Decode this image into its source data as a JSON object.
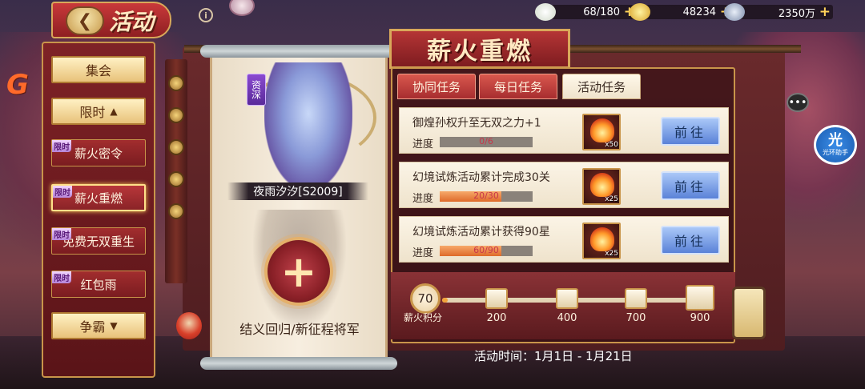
{
  "header": {
    "back_icon": "arrow-left-icon",
    "title": "活动",
    "info_icon": "info-icon"
  },
  "resources": [
    {
      "icon": "steamed-bun-icon",
      "value": "68/180"
    },
    {
      "icon": "gold-ingot-icon",
      "value": "48234"
    },
    {
      "icon": "coin-icon",
      "value": "2350万"
    }
  ],
  "menu": {
    "items": [
      {
        "label": "集会",
        "style": "gold"
      },
      {
        "label": "限时",
        "style": "gold",
        "arrow": "▲"
      },
      {
        "label": "薪火密令",
        "tag": "限时"
      },
      {
        "label": "薪火重燃",
        "tag": "限时",
        "active": true
      },
      {
        "label": "免费无双重生",
        "tag": "限时"
      },
      {
        "label": "红包雨",
        "tag": "限时"
      },
      {
        "label": "争霸",
        "style": "gold",
        "arrow": "▼"
      }
    ]
  },
  "event": {
    "title": "薪火重燃",
    "hero_tag": "资深",
    "hero_name": "夜雨汐汐[S2009]",
    "add_symbol": "+",
    "caption": "结义回归/新征程将军",
    "time_label": "活动时间：1月1日 - 1月21日"
  },
  "tabs": [
    {
      "label": "协同任务",
      "active": false
    },
    {
      "label": "每日任务",
      "active": false
    },
    {
      "label": "活动任务",
      "active": true
    }
  ],
  "tasks": [
    {
      "title": "御煌孙权升至无双之力+1",
      "progress_label": "进度",
      "progress_text": "0/6",
      "progress": 0.0,
      "reward_count": "x50",
      "button": "前往"
    },
    {
      "title": "幻境试炼活动累计完成30关",
      "progress_label": "进度",
      "progress_text": "20/30",
      "progress": 0.667,
      "reward_count": "x25",
      "button": "前往"
    },
    {
      "title": "幻境试炼活动累计获得90星",
      "progress_label": "进度",
      "progress_text": "60/90",
      "progress": 0.667,
      "reward_count": "x25",
      "button": "前往"
    }
  ],
  "points": {
    "value": "70",
    "label": "薪火积分",
    "track_progress": 0.02,
    "milestones": [
      "200",
      "400",
      "700",
      "900"
    ]
  },
  "side": {
    "chat_icon": "chat-bubble-icon",
    "chat_glyph": "•••",
    "helper_big": "光",
    "helper_small": "光环助手"
  },
  "colors": {
    "accent_red": "#a72d2f",
    "accent_gold": "#c9954a",
    "button_blue": "#5a82d8",
    "progress_orange": "#de6a2a"
  }
}
